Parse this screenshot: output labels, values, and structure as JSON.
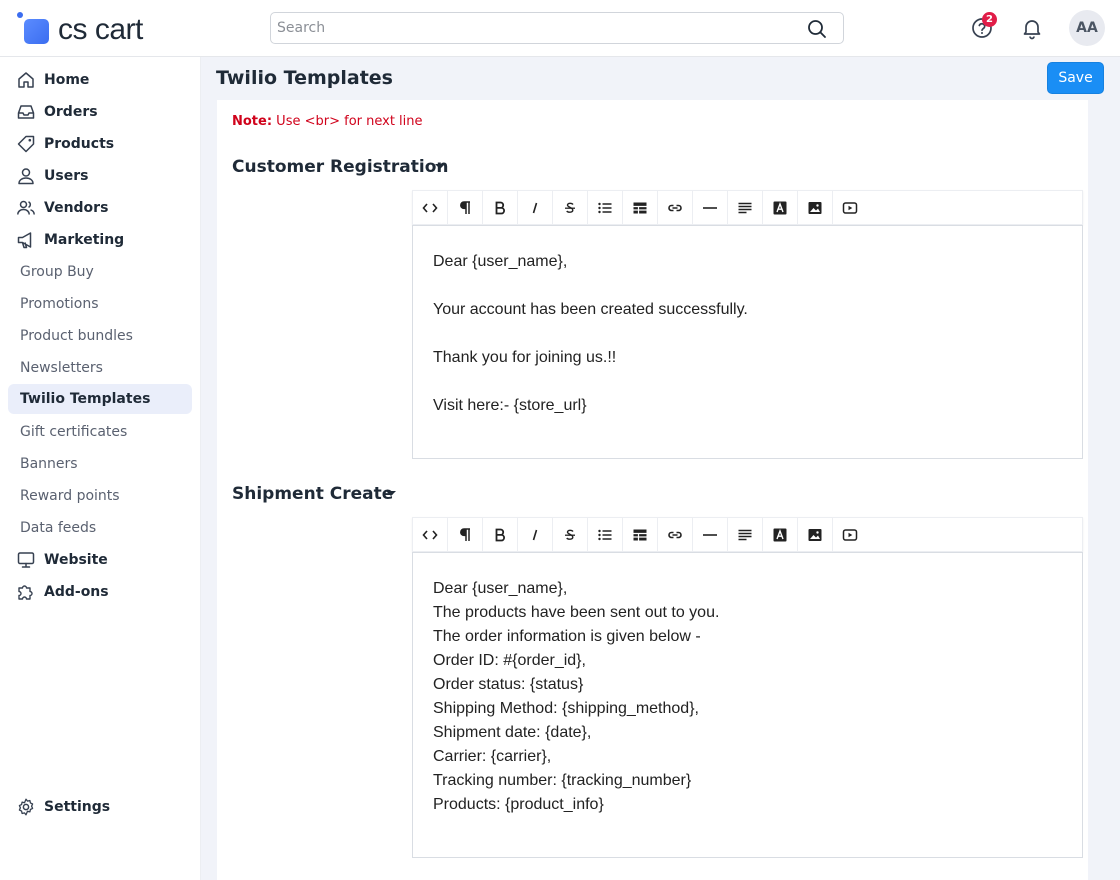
{
  "brand": {
    "name": "cs cart"
  },
  "search": {
    "placeholder": "Search"
  },
  "header": {
    "help_badge_count": "2",
    "avatar_initials": "AA"
  },
  "sidebar": {
    "items": [
      {
        "label": "Home",
        "icon": "home-icon",
        "type": "main"
      },
      {
        "label": "Orders",
        "icon": "inbox-icon",
        "type": "main"
      },
      {
        "label": "Products",
        "icon": "tag-icon",
        "type": "main"
      },
      {
        "label": "Users",
        "icon": "user-icon",
        "type": "main"
      },
      {
        "label": "Vendors",
        "icon": "users-icon",
        "type": "main"
      },
      {
        "label": "Marketing",
        "icon": "megaphone-icon",
        "type": "main"
      },
      {
        "label": "Group Buy",
        "type": "sub"
      },
      {
        "label": "Promotions",
        "type": "sub"
      },
      {
        "label": "Product bundles",
        "type": "sub"
      },
      {
        "label": "Newsletters",
        "type": "sub"
      },
      {
        "label": "Twilio Templates",
        "type": "sub",
        "active": true
      },
      {
        "label": "Gift certificates",
        "type": "sub"
      },
      {
        "label": "Banners",
        "type": "sub"
      },
      {
        "label": "Reward points",
        "type": "sub"
      },
      {
        "label": "Data feeds",
        "type": "sub"
      },
      {
        "label": "Website",
        "icon": "monitor-icon",
        "type": "main"
      },
      {
        "label": "Add-ons",
        "icon": "puzzle-icon",
        "type": "main"
      }
    ],
    "settings_label": "Settings"
  },
  "page": {
    "title": "Twilio Templates",
    "save_label": "Save",
    "note_label": "Note:",
    "note_text": " Use <br> for next line"
  },
  "toolbar_buttons": [
    "code",
    "paragraph",
    "bold",
    "italic",
    "strikethrough",
    "unordered-list",
    "table",
    "link",
    "horizontal-rule",
    "align",
    "text-color",
    "image",
    "video"
  ],
  "sections": [
    {
      "title": "Customer Registration",
      "lines": [
        "Dear {user_name},",
        "",
        "Your account has been created successfully.",
        "",
        "Thank you for joining us.!!",
        "",
        "Visit here:- {store_url}"
      ]
    },
    {
      "title": "Shipment Create",
      "lines": [
        "Dear {user_name},",
        "The products have been sent out to you.",
        "The order information is given below -",
        "Order ID: #{order_id},",
        "Order status: {status}",
        "Shipping Method: {shipping_method},",
        "Shipment date: {date},",
        "Carrier: {carrier},",
        "Tracking number: {tracking_number}",
        "Products: {product_info}"
      ]
    }
  ],
  "colors": {
    "accent": "#1a8ef5",
    "note": "#d0021b",
    "active_bg": "#eaeefa",
    "main_bg": "#f1f3f9"
  }
}
